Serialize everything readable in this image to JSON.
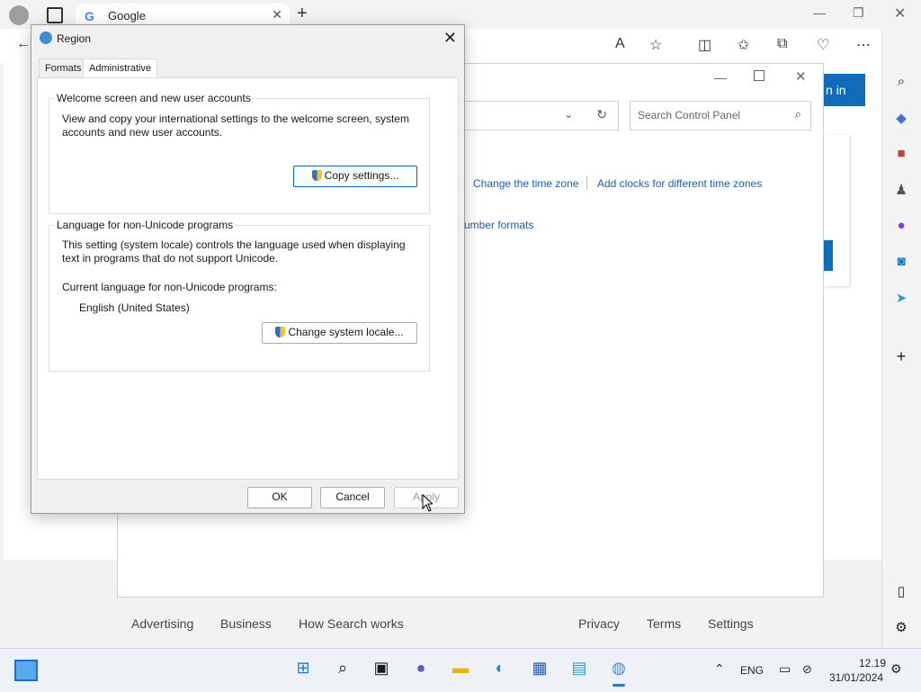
{
  "browser": {
    "tab_title": "Google",
    "tab_close": "✕",
    "new_tab": "+",
    "sidebar_icons": [
      "search-icon",
      "tag-icon",
      "toolbox-icon",
      "chess-icon",
      "copilot-icon",
      "outlook-icon",
      "paper-plane-icon",
      "plus-icon",
      "panel-icon",
      "settings-icon"
    ],
    "signin_label": "n in"
  },
  "footer": {
    "links_left": [
      "Advertising",
      "Business",
      "How Search works"
    ],
    "links_right": [
      "Privacy",
      "Terms",
      "Settings"
    ]
  },
  "control_panel": {
    "search_placeholder": "Search Control Panel",
    "link_time_zone": "Change the time zone",
    "link_clocks": "Add clocks for different time zones",
    "link_number_formats": "umber formats"
  },
  "dialog": {
    "title": "Region",
    "tabs": [
      "Formats",
      "Administrative"
    ],
    "welcome": {
      "heading": "Welcome screen and new user accounts",
      "line1": "View and copy your international settings to the welcome screen, system",
      "line2": "accounts and new user accounts.",
      "button": "Copy settings..."
    },
    "unicode": {
      "heading": "Language for non-Unicode programs",
      "line1": "This setting (system locale) controls the language used when displaying",
      "line2": "text in programs that do not support Unicode.",
      "current_label": "Current language for non-Unicode programs:",
      "current_value": "English (United States)",
      "button": "Change system locale..."
    },
    "buttons": {
      "ok": "OK",
      "cancel": "Cancel",
      "apply": "Apply"
    }
  },
  "taskbar": {
    "language": "ENG",
    "time": "12.19",
    "date": "31/01/2024"
  }
}
